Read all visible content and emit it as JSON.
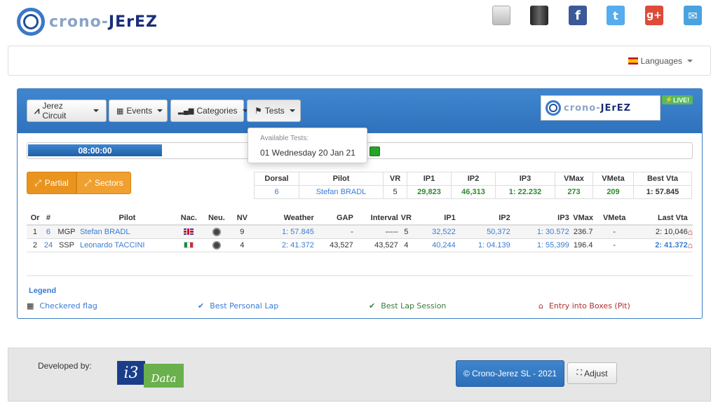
{
  "header": {
    "logo_part1": "crono-",
    "logo_part2": "JErEZ"
  },
  "social": [
    {
      "name": "gray-box-icon",
      "color": "#d0d0d0"
    },
    {
      "name": "dark-panel-icon",
      "color": "#333333"
    },
    {
      "name": "facebook-icon",
      "color": "#3b5998",
      "glyph": "f"
    },
    {
      "name": "twitter-icon",
      "color": "#55acee",
      "glyph": "t"
    },
    {
      "name": "google-plus-icon",
      "color": "#dd4b39",
      "glyph": "g+"
    },
    {
      "name": "email-icon",
      "color": "#4aa3df",
      "glyph": "✉"
    }
  ],
  "nav": {
    "languages": "Languages"
  },
  "toolbar": {
    "circuit": "Jerez Circuit",
    "events": "Events",
    "categories": "Categories",
    "tests": "Tests",
    "live": "LIVE!"
  },
  "tests_menu": {
    "header": "Available Tests:",
    "item": "01 Wednesday 20 Jan 21"
  },
  "timer": {
    "value": "08:00:00",
    "progress": 0.2
  },
  "view_toggle": {
    "partial": "Partial",
    "sectors": "Sectors"
  },
  "summary": {
    "headers": [
      "Dorsal",
      "Pilot",
      "VR",
      "IP1",
      "IP2",
      "IP3",
      "VMax",
      "VMeta",
      "Best Vta"
    ],
    "row": {
      "dorsal": "6",
      "pilot": "Stefan BRADL",
      "vr": "5",
      "ip1": "29,823",
      "ip2": "46,313",
      "ip3": "1: 22.232",
      "vmax": "273",
      "vmeta": "209",
      "best": "1: 57.845"
    }
  },
  "table": {
    "headers": [
      "Or",
      "#",
      "",
      "Pilot",
      "Nac.",
      "Neu.",
      "NV",
      "Weather",
      "GAP",
      "Interval",
      "VR",
      "IP1",
      "IP2",
      "IP3",
      "VMax",
      "VMeta",
      "Last Vta",
      ""
    ],
    "rows": [
      {
        "or": "1",
        "num": "6",
        "cat": "MGP",
        "pilot": "Stefan BRADL",
        "nat": "gb",
        "nv": "9",
        "weather": "1: 57.845",
        "gap": "-",
        "interval": "-----",
        "vr": "5",
        "ip1": "32,522",
        "ip2": "50,372",
        "ip3": "1: 30.572",
        "vmax": "236.7",
        "vmeta": "-",
        "last": "2: 10,046"
      },
      {
        "or": "2",
        "num": "24",
        "cat": "SSP",
        "pilot": "Leonardo TACCINI",
        "nat": "it",
        "nv": "4",
        "weather": "2: 41.372",
        "gap": "43,527",
        "interval": "43,527",
        "vr": "4",
        "ip1": "40,244",
        "ip2": "1: 04.139",
        "ip3": "1: 55,399",
        "vmax": "196.4",
        "vmeta": "-",
        "last": "2: 41.372"
      }
    ]
  },
  "legend": {
    "title": "Legend",
    "items": [
      "Checkered flag",
      "Best Personal Lap",
      "Best Lap Session",
      "Entry into Boxes (Pit)"
    ]
  },
  "footer": {
    "developed_by": "Developed by:",
    "i3": "i3",
    "data_word": "Data",
    "copyright": "© Crono-Jerez SL - 2021",
    "adjust": "Adjust"
  }
}
